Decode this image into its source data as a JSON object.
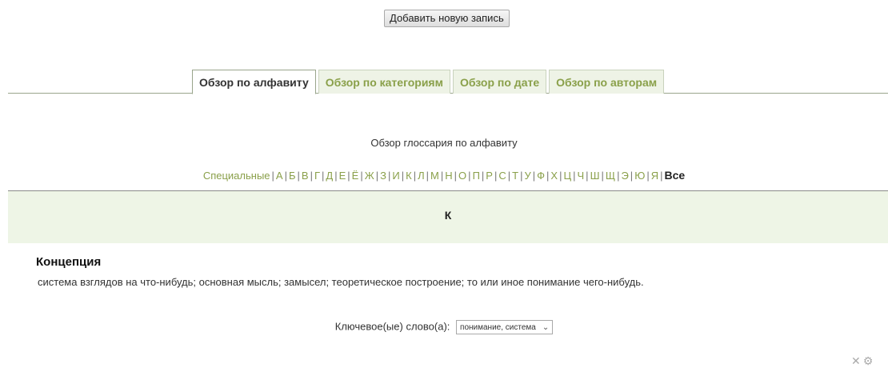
{
  "toolbar": {
    "add_entry_label": "Добавить новую запись"
  },
  "tabs": [
    {
      "label": "Обзор по алфавиту",
      "active": true
    },
    {
      "label": "Обзор по категориям",
      "active": false
    },
    {
      "label": "Обзор по дате",
      "active": false
    },
    {
      "label": "Обзор по авторам",
      "active": false
    }
  ],
  "browse": {
    "title": "Обзор глоссария по алфавиту"
  },
  "alphabet": {
    "special": "Специальные",
    "letters": [
      "А",
      "Б",
      "В",
      "Г",
      "Д",
      "Е",
      "Ё",
      "Ж",
      "З",
      "И",
      "К",
      "Л",
      "М",
      "Н",
      "О",
      "П",
      "Р",
      "С",
      "Т",
      "У",
      "Ф",
      "Х",
      "Ц",
      "Ч",
      "Ш",
      "Щ",
      "Э",
      "Ю",
      "Я"
    ],
    "all": "Все"
  },
  "section": {
    "letter": "К"
  },
  "entry": {
    "term": "Концепция",
    "definition": "система взглядов на что-нибудь; основная мысль; замысел; теоретическое построение; то или иное понимание чего-нибудь."
  },
  "keywords": {
    "label": "Ключевое(ые) слово(а):",
    "selected": "понимание, система"
  },
  "icons": {
    "delete": "close-icon",
    "settings": "gear-icon"
  },
  "colors": {
    "link_green": "#8aa04a",
    "band_bg": "#eef5e6"
  }
}
